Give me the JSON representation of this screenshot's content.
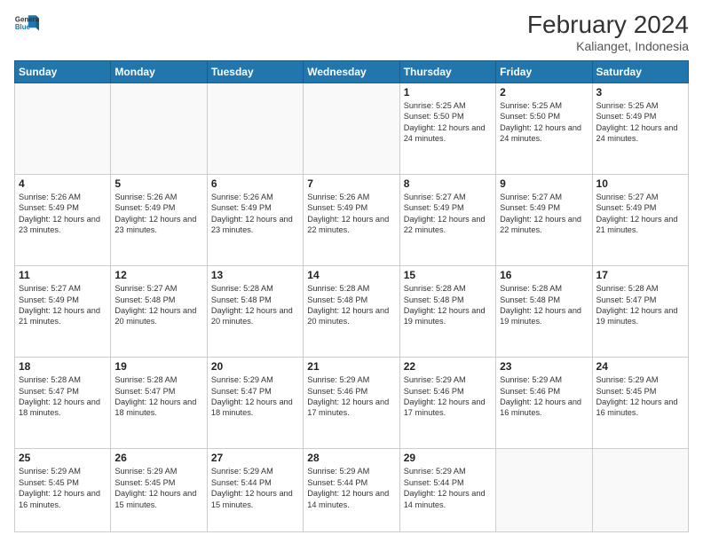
{
  "header": {
    "logo_line1": "General",
    "logo_line2": "Blue",
    "title": "February 2024",
    "subtitle": "Kalianget, Indonesia"
  },
  "days_of_week": [
    "Sunday",
    "Monday",
    "Tuesday",
    "Wednesday",
    "Thursday",
    "Friday",
    "Saturday"
  ],
  "weeks": [
    [
      {
        "date": "",
        "info": ""
      },
      {
        "date": "",
        "info": ""
      },
      {
        "date": "",
        "info": ""
      },
      {
        "date": "",
        "info": ""
      },
      {
        "date": "1",
        "info": "Sunrise: 5:25 AM\nSunset: 5:50 PM\nDaylight: 12 hours and 24 minutes."
      },
      {
        "date": "2",
        "info": "Sunrise: 5:25 AM\nSunset: 5:50 PM\nDaylight: 12 hours and 24 minutes."
      },
      {
        "date": "3",
        "info": "Sunrise: 5:25 AM\nSunset: 5:49 PM\nDaylight: 12 hours and 24 minutes."
      }
    ],
    [
      {
        "date": "4",
        "info": "Sunrise: 5:26 AM\nSunset: 5:49 PM\nDaylight: 12 hours and 23 minutes."
      },
      {
        "date": "5",
        "info": "Sunrise: 5:26 AM\nSunset: 5:49 PM\nDaylight: 12 hours and 23 minutes."
      },
      {
        "date": "6",
        "info": "Sunrise: 5:26 AM\nSunset: 5:49 PM\nDaylight: 12 hours and 23 minutes."
      },
      {
        "date": "7",
        "info": "Sunrise: 5:26 AM\nSunset: 5:49 PM\nDaylight: 12 hours and 22 minutes."
      },
      {
        "date": "8",
        "info": "Sunrise: 5:27 AM\nSunset: 5:49 PM\nDaylight: 12 hours and 22 minutes."
      },
      {
        "date": "9",
        "info": "Sunrise: 5:27 AM\nSunset: 5:49 PM\nDaylight: 12 hours and 22 minutes."
      },
      {
        "date": "10",
        "info": "Sunrise: 5:27 AM\nSunset: 5:49 PM\nDaylight: 12 hours and 21 minutes."
      }
    ],
    [
      {
        "date": "11",
        "info": "Sunrise: 5:27 AM\nSunset: 5:49 PM\nDaylight: 12 hours and 21 minutes."
      },
      {
        "date": "12",
        "info": "Sunrise: 5:27 AM\nSunset: 5:48 PM\nDaylight: 12 hours and 20 minutes."
      },
      {
        "date": "13",
        "info": "Sunrise: 5:28 AM\nSunset: 5:48 PM\nDaylight: 12 hours and 20 minutes."
      },
      {
        "date": "14",
        "info": "Sunrise: 5:28 AM\nSunset: 5:48 PM\nDaylight: 12 hours and 20 minutes."
      },
      {
        "date": "15",
        "info": "Sunrise: 5:28 AM\nSunset: 5:48 PM\nDaylight: 12 hours and 19 minutes."
      },
      {
        "date": "16",
        "info": "Sunrise: 5:28 AM\nSunset: 5:48 PM\nDaylight: 12 hours and 19 minutes."
      },
      {
        "date": "17",
        "info": "Sunrise: 5:28 AM\nSunset: 5:47 PM\nDaylight: 12 hours and 19 minutes."
      }
    ],
    [
      {
        "date": "18",
        "info": "Sunrise: 5:28 AM\nSunset: 5:47 PM\nDaylight: 12 hours and 18 minutes."
      },
      {
        "date": "19",
        "info": "Sunrise: 5:28 AM\nSunset: 5:47 PM\nDaylight: 12 hours and 18 minutes."
      },
      {
        "date": "20",
        "info": "Sunrise: 5:29 AM\nSunset: 5:47 PM\nDaylight: 12 hours and 18 minutes."
      },
      {
        "date": "21",
        "info": "Sunrise: 5:29 AM\nSunset: 5:46 PM\nDaylight: 12 hours and 17 minutes."
      },
      {
        "date": "22",
        "info": "Sunrise: 5:29 AM\nSunset: 5:46 PM\nDaylight: 12 hours and 17 minutes."
      },
      {
        "date": "23",
        "info": "Sunrise: 5:29 AM\nSunset: 5:46 PM\nDaylight: 12 hours and 16 minutes."
      },
      {
        "date": "24",
        "info": "Sunrise: 5:29 AM\nSunset: 5:45 PM\nDaylight: 12 hours and 16 minutes."
      }
    ],
    [
      {
        "date": "25",
        "info": "Sunrise: 5:29 AM\nSunset: 5:45 PM\nDaylight: 12 hours and 16 minutes."
      },
      {
        "date": "26",
        "info": "Sunrise: 5:29 AM\nSunset: 5:45 PM\nDaylight: 12 hours and 15 minutes."
      },
      {
        "date": "27",
        "info": "Sunrise: 5:29 AM\nSunset: 5:44 PM\nDaylight: 12 hours and 15 minutes."
      },
      {
        "date": "28",
        "info": "Sunrise: 5:29 AM\nSunset: 5:44 PM\nDaylight: 12 hours and 14 minutes."
      },
      {
        "date": "29",
        "info": "Sunrise: 5:29 AM\nSunset: 5:44 PM\nDaylight: 12 hours and 14 minutes."
      },
      {
        "date": "",
        "info": ""
      },
      {
        "date": "",
        "info": ""
      }
    ]
  ]
}
